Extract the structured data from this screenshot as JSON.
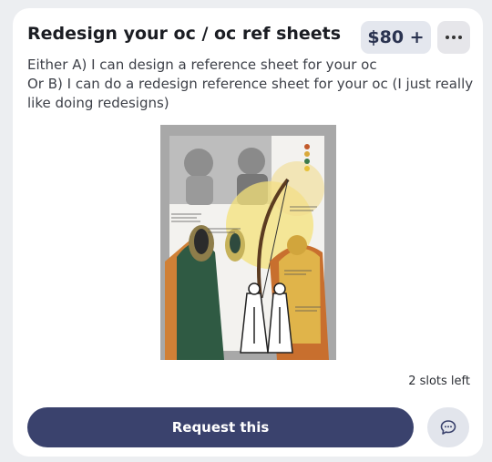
{
  "listing": {
    "title": "Redesign your oc / oc ref sheets",
    "price": "$80 +",
    "description_lines": [
      "Either A) I can design a reference sheet for your oc",
      "Or B) I can do a redesign reference sheet for your oc (I just really like doing redesigns)"
    ],
    "slots_left": "2 slots left",
    "request_label": "Request this"
  },
  "icons": {
    "more": "more-horizontal-icon",
    "chat": "chat-bubble-icon"
  },
  "colors": {
    "primary": "#3a426d",
    "price_bg": "#e4e7ee",
    "card_bg": "#ffffff",
    "page_bg": "#eceef1"
  }
}
